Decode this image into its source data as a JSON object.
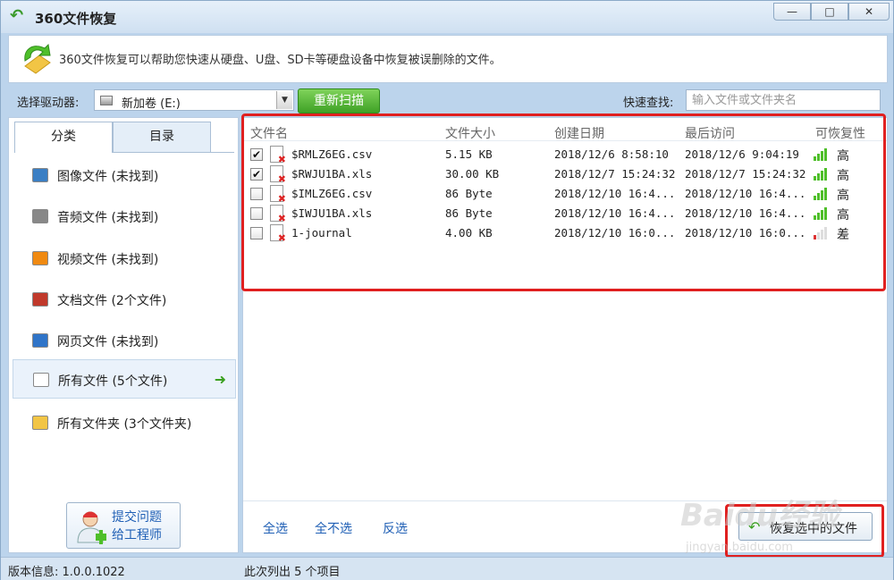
{
  "window": {
    "title": "360文件恢复",
    "min": "—",
    "max": "□",
    "close": "✕"
  },
  "banner": {
    "text": "360文件恢复可以帮助您快速从硬盘、U盘、SD卡等硬盘设备中恢复被误删除的文件。"
  },
  "drive": {
    "label": "选择驱动器:",
    "value": "新加卷 (E:)",
    "rescan": "重新扫描"
  },
  "search": {
    "label": "快速查找:",
    "placeholder": "输入文件或文件夹名"
  },
  "tabs": {
    "category": "分类",
    "directory": "目录"
  },
  "categories": [
    {
      "label": "图像文件 (未找到)",
      "icon": "image-icon",
      "color": "#3b7fc4"
    },
    {
      "label": "音频文件 (未找到)",
      "icon": "music-icon",
      "color": "#888888"
    },
    {
      "label": "视频文件 (未找到)",
      "icon": "video-icon",
      "color": "#f08a12"
    },
    {
      "label": "文档文件 (2个文件)",
      "icon": "document-icon",
      "color": "#c0392b"
    },
    {
      "label": "网页文件 (未找到)",
      "icon": "webpage-icon",
      "color": "#2f74c8"
    },
    {
      "label": "所有文件 (5个文件)",
      "icon": "file-icon",
      "color": "#ffffff"
    },
    {
      "label": "所有文件夹 (3个文件夹)",
      "icon": "folder-icon",
      "color": "#f2c545"
    }
  ],
  "feedback": {
    "line1": "提交问题",
    "line2": "给工程师"
  },
  "table": {
    "columns": [
      "文件名",
      "文件大小",
      "创建日期",
      "最后访问",
      "可恢复性"
    ],
    "rows": [
      {
        "checked": true,
        "name": "$RMLZ6EG.csv",
        "size": "5.15 KB",
        "created": "2018/12/6 8:58:10",
        "accessed": "2018/12/6 9:04:19",
        "recoverability": "高",
        "level": "high"
      },
      {
        "checked": true,
        "name": "$RWJU1BA.xls",
        "size": "30.00 KB",
        "created": "2018/12/7 15:24:32",
        "accessed": "2018/12/7 15:24:32",
        "recoverability": "高",
        "level": "high"
      },
      {
        "checked": false,
        "name": "$IMLZ6EG.csv",
        "size": "86 Byte",
        "created": "2018/12/10 16:4...",
        "accessed": "2018/12/10 16:4...",
        "recoverability": "高",
        "level": "high"
      },
      {
        "checked": false,
        "name": "$IWJU1BA.xls",
        "size": "86 Byte",
        "created": "2018/12/10 16:4...",
        "accessed": "2018/12/10 16:4...",
        "recoverability": "高",
        "level": "high"
      },
      {
        "checked": false,
        "name": "1-journal",
        "size": "4.00 KB",
        "created": "2018/12/10 16:0...",
        "accessed": "2018/12/10 16:0...",
        "recoverability": "差",
        "level": "low"
      }
    ]
  },
  "actions": {
    "select_all": "全选",
    "select_none": "全不选",
    "invert": "反选",
    "recover": "恢复选中的文件"
  },
  "status": {
    "version": "版本信息: 1.0.0.1022",
    "count": "此次列出 5 个项目"
  },
  "watermark": {
    "logo": "Baidu经验",
    "url": "jingyan.baidu.com"
  }
}
